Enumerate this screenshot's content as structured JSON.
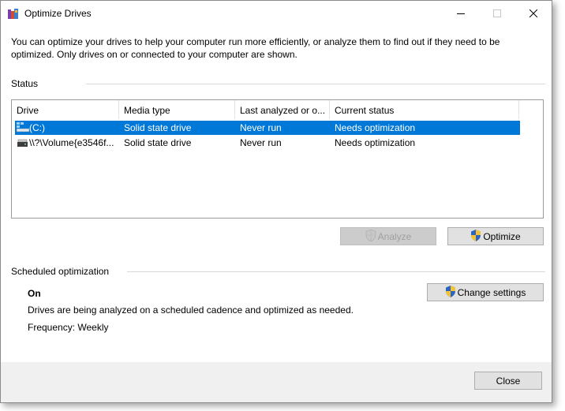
{
  "window": {
    "title": "Optimize Drives"
  },
  "intro": "You can optimize your drives to help your computer run more efficiently, or analyze them to find out if they need to be optimized. Only drives on or connected to your computer are shown.",
  "status": {
    "label": "Status",
    "columns": [
      "Drive",
      "Media type",
      "Last analyzed or o...",
      "Current status"
    ],
    "rows": [
      {
        "drive": "(C:)",
        "media": "Solid state drive",
        "last": "Never run",
        "current": "Needs optimization",
        "selected": true
      },
      {
        "drive": "\\\\?\\Volume{e3546f...",
        "media": "Solid state drive",
        "last": "Never run",
        "current": "Needs optimization",
        "selected": false
      }
    ]
  },
  "buttons": {
    "analyze": "Analyze",
    "optimize": "Optimize",
    "change_settings": "Change settings",
    "close": "Close"
  },
  "scheduled": {
    "label": "Scheduled optimization",
    "state": "On",
    "description": "Drives are being analyzed on a scheduled cadence and optimized as needed.",
    "frequency": "Frequency: Weekly"
  },
  "colors": {
    "selection": "#0078d7"
  }
}
